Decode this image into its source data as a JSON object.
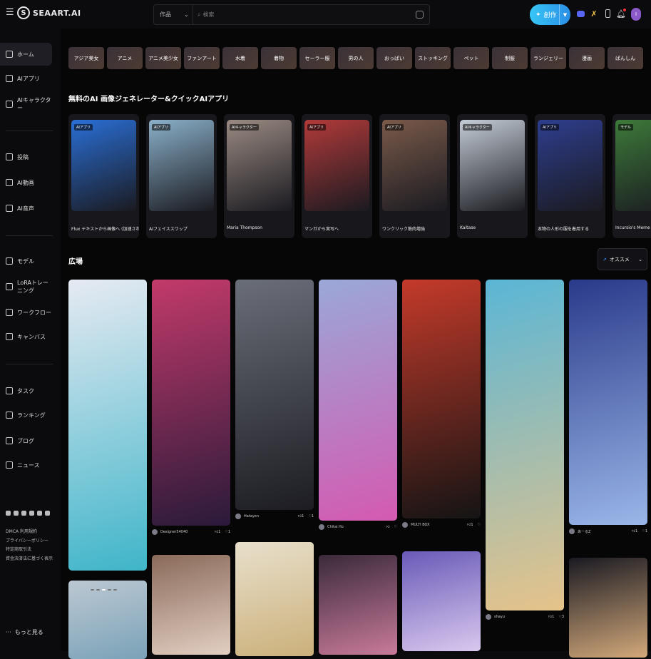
{
  "app": {
    "brand": "SEAART.AI",
    "brand_mark": "S"
  },
  "search": {
    "category": "作品",
    "placeholder": "検索"
  },
  "header": {
    "create_label": "創作",
    "avatar_initial": "I"
  },
  "sidebar": {
    "items": [
      {
        "label": "ホーム",
        "icon": "home-icon",
        "active": true
      },
      {
        "label": "AIアプリ",
        "icon": "app-icon"
      },
      {
        "label": "AIキャラクター",
        "icon": "character-icon"
      },
      {
        "label": "投稿",
        "icon": "post-icon"
      },
      {
        "label": "AI動画",
        "icon": "video-icon"
      },
      {
        "label": "AI音声",
        "icon": "audio-icon"
      },
      {
        "label": "モデル",
        "icon": "model-icon"
      },
      {
        "label": "LoRAトレーニング",
        "icon": "lora-icon"
      },
      {
        "label": "ワークフロー",
        "icon": "workflow-icon"
      },
      {
        "label": "キャンバス",
        "icon": "canvas-icon"
      },
      {
        "label": "タスク",
        "icon": "task-icon"
      },
      {
        "label": "ランキング",
        "icon": "ranking-icon"
      },
      {
        "label": "ブログ",
        "icon": "blog-icon"
      },
      {
        "label": "ニュース",
        "icon": "news-icon"
      }
    ],
    "footer_links": [
      "DMCA 利用規約",
      "プライバシーポリシー",
      "特定商取引法",
      "資金決済法に基づく表示"
    ],
    "more_label": "もっと見る"
  },
  "categories": [
    "アジア美女",
    "アニメ",
    "アニメ美少女",
    "ファンアート",
    "水着",
    "着物",
    "セーラー服",
    "男の人",
    "おっぱい",
    "ストッキング",
    "ペット",
    "制服",
    "ランジェリー",
    "漫画",
    "ぱんしん"
  ],
  "apps_section": {
    "title": "無料のAI 画像ジェネレーター&クイックAIアプリ",
    "items": [
      {
        "tag": "AIアプリ",
        "name": "Flux テキストから画像へ (加速された)",
        "color": "#2a6fd6"
      },
      {
        "tag": "AIアプリ",
        "name": "AIフェイススワップ",
        "color": "#8ab0c9"
      },
      {
        "tag": "AIキャラクター",
        "name": "Maria Thompson",
        "color": "#9a8a82"
      },
      {
        "tag": "AIアプリ",
        "name": "マンガから実写へ",
        "color": "#b23a3a"
      },
      {
        "tag": "AIアプリ",
        "name": "ワンクリック筋肉増強",
        "color": "#7a5a4a"
      },
      {
        "tag": "AIキャラクター",
        "name": "Kaitase",
        "color": "#c4ccd6"
      },
      {
        "tag": "AIアプリ",
        "name": "本物の人形の服を着用する",
        "color": "#2e3e8e"
      },
      {
        "tag": "モデル",
        "name": "Incursio's Meme Diffusion",
        "color": "#3d7a3a"
      }
    ]
  },
  "feed": {
    "title": "広場",
    "sort_label": "オススメ",
    "cards": [
      {
        "user": "",
        "likes": "",
        "comments": "",
        "colors": [
          "#e6eaf2",
          "#3fb5c9"
        ]
      },
      {
        "user": "Designer54040",
        "likes": "1",
        "comments": "1",
        "colors": [
          "#c23a6a",
          "#2a1a3a"
        ]
      },
      {
        "user": "Hatayen",
        "likes": "1",
        "comments": "1",
        "colors": [
          "#6a6e78",
          "#1c1c22"
        ]
      },
      {
        "user": "Chitai Ho",
        "likes": "",
        "comments": "",
        "colors": [
          "#9aa8d8",
          "#d45ab0"
        ]
      },
      {
        "user": "MULTI BOX",
        "likes": "1",
        "comments": "",
        "colors": [
          "#c43a2a",
          "#141414"
        ]
      },
      {
        "user": "shayu",
        "likes": "1",
        "comments": "3",
        "colors": [
          "#5ab6d6",
          "#e6c38a"
        ]
      },
      {
        "user": "あーるZ",
        "likes": "1",
        "comments": "1",
        "colors": [
          "#2a3a8a",
          "#9ab6e8"
        ]
      },
      {
        "user": "",
        "likes": "",
        "comments": "",
        "colors": [
          "#bcc8d2",
          "#7aa2b8"
        ]
      },
      {
        "user": "",
        "likes": "",
        "comments": "",
        "colors": [
          "#8a6a5a",
          "#e2cfc2"
        ]
      },
      {
        "user": "",
        "likes": "",
        "comments": "",
        "colors": [
          "#e8e0cc",
          "#cbb07a"
        ]
      },
      {
        "user": "",
        "likes": "",
        "comments": "",
        "colors": [
          "#3a2a3a",
          "#c87a9a"
        ]
      },
      {
        "user": "",
        "likes": "",
        "comments": "",
        "colors": [
          "#6a5ab8",
          "#d8c8ee"
        ]
      },
      {
        "user": "",
        "likes": "",
        "comments": "",
        "colors": [
          "#1a1a22",
          "#d2a87a"
        ]
      }
    ]
  }
}
